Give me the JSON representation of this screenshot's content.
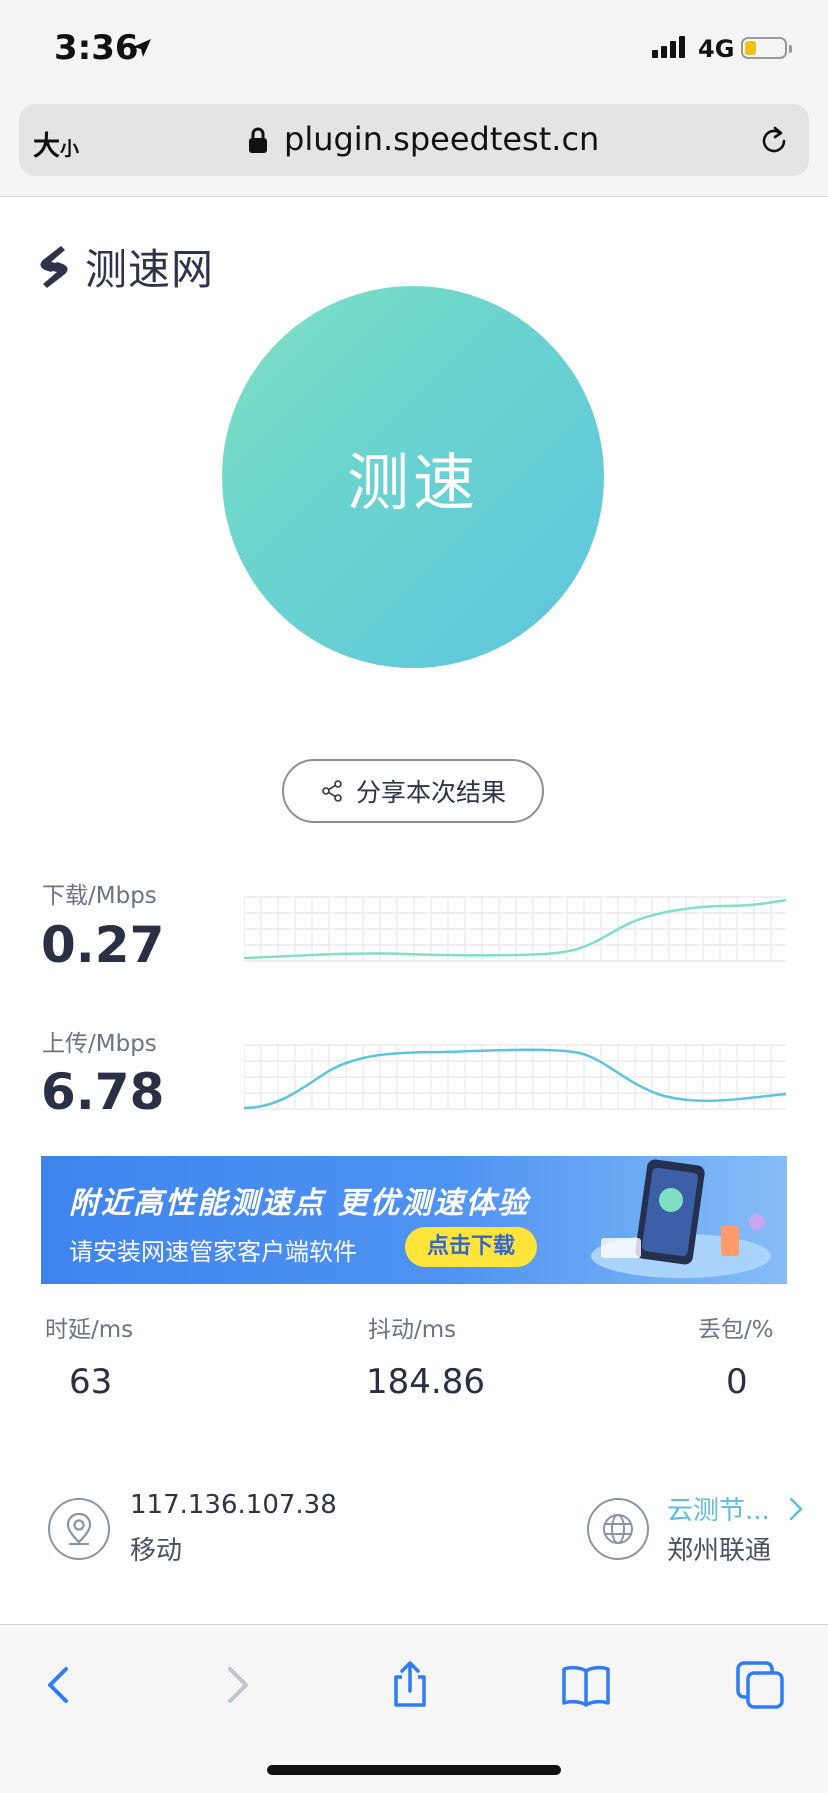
{
  "status_bar": {
    "time": "3:36",
    "network": "4G",
    "battery_level_percent": 30
  },
  "browser": {
    "text_size_label": "大",
    "text_size_small": "小",
    "url": "plugin.speedtest.cn"
  },
  "logo": {
    "text": "测速网"
  },
  "start_button": {
    "label": "测速"
  },
  "share_button": {
    "label": "分享本次结果"
  },
  "download": {
    "label": "下载/Mbps",
    "value": "0.27"
  },
  "upload": {
    "label": "上传/Mbps",
    "value": "6.78"
  },
  "banner": {
    "title": "附近高性能测速点  更优测速体验",
    "subtitle": "请安装网速管家客户端软件",
    "button": "点击下载"
  },
  "stats": [
    {
      "label": "时延/ms",
      "value": "63"
    },
    {
      "label": "抖动/ms",
      "value": "184.86"
    },
    {
      "label": "丢包/%",
      "value": "0"
    }
  ],
  "client": {
    "ip": "117.136.107.38",
    "isp": "移动"
  },
  "server": {
    "link": "云测节...",
    "name": "郑州联通"
  },
  "colors": {
    "accent_green": "#7fe0c4",
    "accent_blue": "#5dc4de",
    "link": "#5bbde0",
    "safari_blue": "#2f7cf6"
  }
}
